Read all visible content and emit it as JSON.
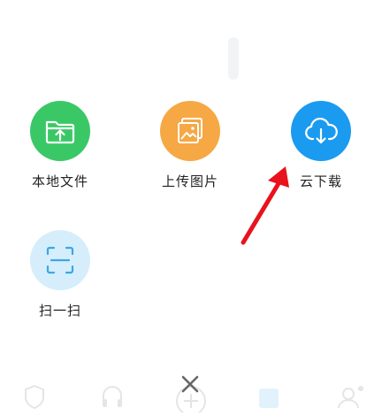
{
  "menu": {
    "items": [
      {
        "label": "本地文件",
        "icon": "folder-upload-icon",
        "color": "#3ac867"
      },
      {
        "label": "上传图片",
        "icon": "image-upload-icon",
        "color": "#f5a844"
      },
      {
        "label": "云下载",
        "icon": "cloud-download-icon",
        "color": "#1a9bf0"
      },
      {
        "label": "扫一扫",
        "icon": "scan-icon",
        "color": "#d6eefc",
        "icon_color": "#3ba7e6"
      }
    ]
  },
  "close": {
    "icon": "close-icon",
    "color": "#666666"
  },
  "annotation": {
    "arrow_color": "#e8131c"
  }
}
